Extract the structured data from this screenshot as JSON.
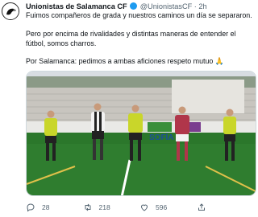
{
  "tweet": {
    "author_name": "Unionistas de Salamanca CF",
    "handle": "@UnionistasCF",
    "time": "2h",
    "separator": "·",
    "paragraphs": [
      "Fuimos compañeros de grada y nuestros caminos un día se separaron.",
      "Pero por encima de rivalidades y distintas maneras de entender el fútbol, somos charros.",
      "Por Salamanca: pedimos a ambas aficiones respeto mutuo 🙏"
    ],
    "banner_text": "SOFÍA"
  },
  "actions": {
    "reply_count": "28",
    "retweet_count": "218",
    "like_count": "596"
  },
  "icons": [
    "avatar-logo",
    "verified-icon",
    "reply-icon",
    "retweet-icon",
    "like-icon",
    "share-icon"
  ],
  "colors": {
    "verified": "#1d9bf0",
    "muted": "#536471",
    "pitch": "#2f7d2f"
  }
}
